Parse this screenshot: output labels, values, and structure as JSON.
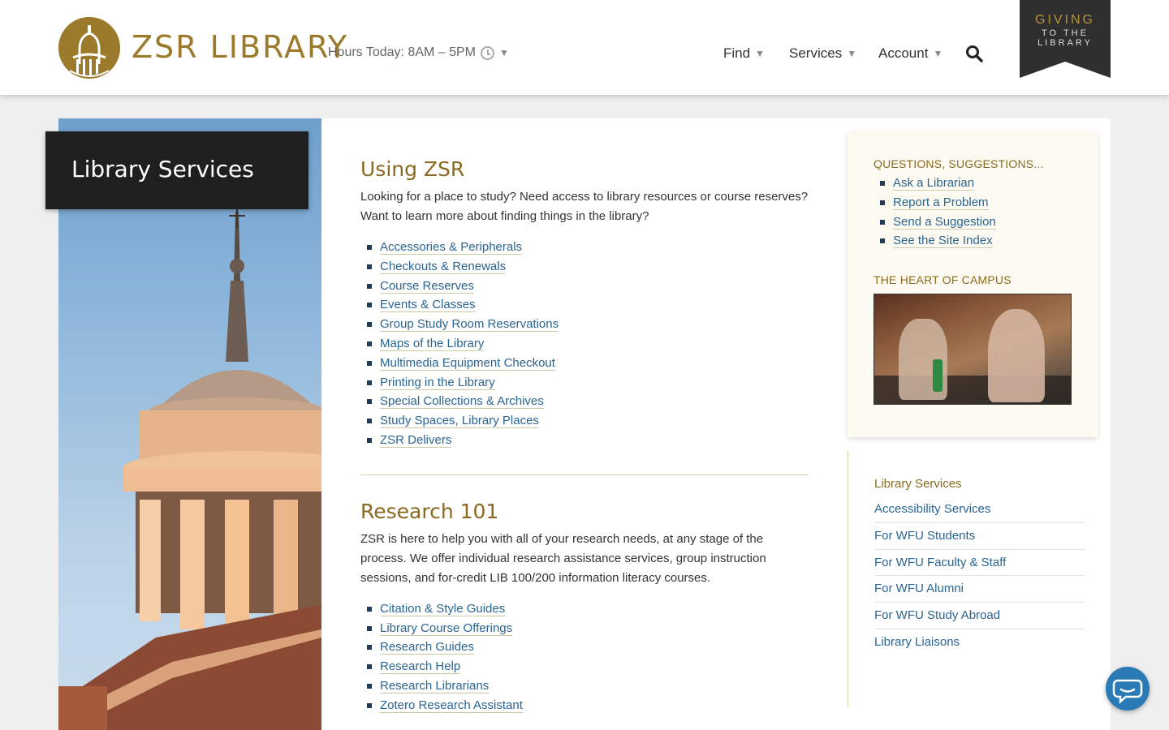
{
  "header": {
    "logo_text": "ZSR LIBRARY",
    "hours": "Hours Today: 8AM – 5PM",
    "nav": [
      {
        "label": "Find"
      },
      {
        "label": "Services"
      },
      {
        "label": "Account"
      }
    ],
    "giving": {
      "line1": "GIVING",
      "line2": "TO THE",
      "line3": "LIBRARY"
    }
  },
  "hero": {
    "title": "Library Services"
  },
  "sections": [
    {
      "heading": "Using ZSR",
      "intro": "Looking for a place to study? Need access to library resources or course reserves? Want to learn more about finding things in the library?",
      "links": [
        "Accessories & Peripherals",
        "Checkouts & Renewals",
        "Course Reserves",
        "Events & Classes",
        "Group Study Room Reservations",
        "Maps of the Library",
        "Multimedia Equipment Checkout",
        "Printing in the Library",
        "Special Collections & Archives",
        "Study Spaces, Library Places",
        "ZSR Delivers"
      ]
    },
    {
      "heading": "Research 101",
      "intro": "ZSR is here to help you with all of your research needs, at any stage of the process. We offer individual research assistance services, group instruction sessions, and for-credit LIB 100/200 information literacy courses.",
      "links": [
        "Citation & Style Guides",
        "Library Course Offerings",
        "Research Guides",
        "Research Help",
        "Research Librarians",
        "Zotero Research Assistant"
      ]
    }
  ],
  "sidebar": {
    "questions_heading": "QUESTIONS, SUGGESTIONS...",
    "question_links": [
      "Ask a Librarian",
      "Report a Problem",
      "Send a Suggestion",
      "See the Site Index"
    ],
    "heart_heading": "THE HEART OF CAMPUS",
    "subnav_heading": "Library Services",
    "subnav_links": [
      "Accessibility Services",
      "For WFU Students",
      "For WFU Faculty & Staff",
      "For WFU Alumni",
      "For WFU Study Abroad",
      "Library Liaisons"
    ]
  },
  "colors": {
    "brand_gold": "#9c7a2c",
    "link_blue": "#2a6491",
    "dark": "#1f1f1f",
    "chat_blue": "#2a7ab5"
  },
  "icons": [
    "logo-icon",
    "clock-icon",
    "chevron-down-icon",
    "search-icon",
    "chat-icon"
  ]
}
